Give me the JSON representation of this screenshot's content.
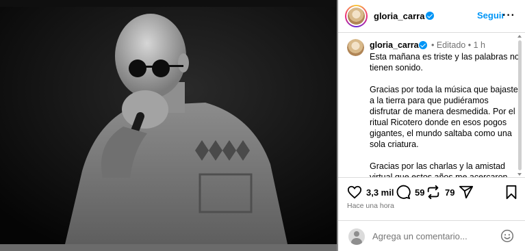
{
  "post": {
    "username": "gloria_carra",
    "follow_label": "Seguir",
    "more_label": "···"
  },
  "caption": {
    "username": "gloria_carra",
    "meta": "• Editado • 1 h",
    "paragraphs": [
      "Esta mañana es triste y las palabras no tienen sonido.",
      "Gracias por toda la música que bajaste a la tierra para que pudiéramos disfrutar de manera desmedida. Por el ritual Ricotero donde en esos pogos gigantes, el mundo saltaba como una sola criatura.",
      "Gracias por las charlas y la amistad virtual que estos años me acercaron más..."
    ]
  },
  "actions": {
    "likes": "3,3 mil",
    "comments": "59",
    "reposts": "79"
  },
  "timestamp": "Hace una hora",
  "comment_box": {
    "placeholder": "Agrega un comentario..."
  },
  "icons": {
    "like": "heart-icon",
    "comment": "comment-bubble-icon",
    "repost": "repost-icon",
    "share": "send-icon",
    "save": "bookmark-icon",
    "emoji": "smiley-icon",
    "verified": "verified-badge-icon"
  },
  "colors": {
    "accent": "#0095f6",
    "muted": "#737373",
    "border": "#dbdbdb"
  }
}
